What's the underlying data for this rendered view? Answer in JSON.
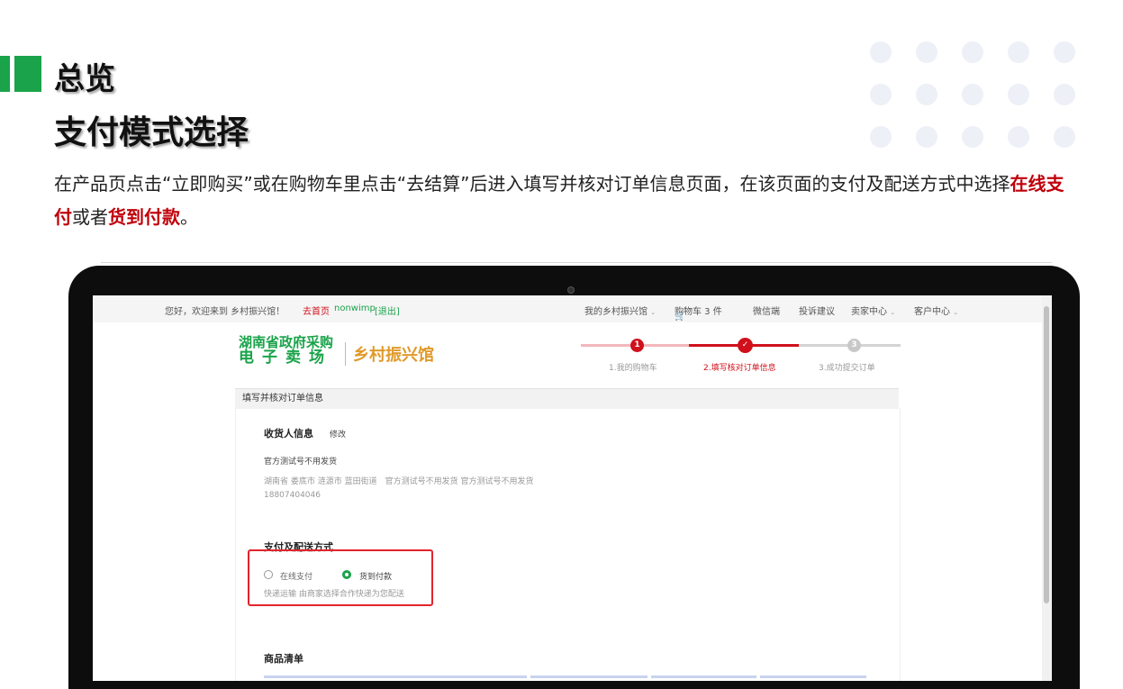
{
  "slide": {
    "title": "总览",
    "subtitle": "支付模式选择",
    "description": {
      "part1": "在产品页点击“立即购买”或在购物车里点击“去结算”后进入填写并核对订单信息页面，在该页面的支付及配送方式中选择",
      "highlight1": "在线支付",
      "part2": "或者",
      "highlight2": "货到付款",
      "part3": "。"
    },
    "colors": {
      "accent": "#1aa34a",
      "highlight": "#c0000a",
      "frame": "#e3242b"
    }
  },
  "screen": {
    "topbar": {
      "welcome": "您好，欢迎来到 乡村振兴馆！",
      "home_link": "去首页",
      "username": "nonwimp",
      "logout": "[退出]",
      "my_store": "我的乡村振兴馆",
      "cart": "购物车 3 件",
      "wechat": "微信端",
      "feedback": "投诉建议",
      "seller_center": "卖家中心",
      "customer_center": "客户中心"
    },
    "logo": {
      "gov_line1": "湖南省政府采购",
      "gov_line2": "电子卖场",
      "village": "乡村振兴馆"
    },
    "steps": [
      {
        "num": "1",
        "label": "1.我的购物车"
      },
      {
        "num": "✓",
        "label": "2.填写核对订单信息"
      },
      {
        "num": "3",
        "label": "3.成功提交订单"
      }
    ],
    "panel_title": "填写并核对订单信息",
    "consignee": {
      "section_title": "收货人信息",
      "edit": "修改",
      "name": "官方测试号不用发货",
      "address": "湖南省 娄底市 涟源市 蓝田街道　官方测试号不用发货 官方测试号不用发货",
      "phone": "18807404046"
    },
    "payment": {
      "section_title": "支付及配送方式",
      "option_online": "在线支付",
      "option_cod": "货到付款",
      "selected": "货到付款",
      "delivery_note": "快递运输 由商家选择合作快递为您配送"
    },
    "goods": {
      "section_title": "商品清单"
    }
  }
}
